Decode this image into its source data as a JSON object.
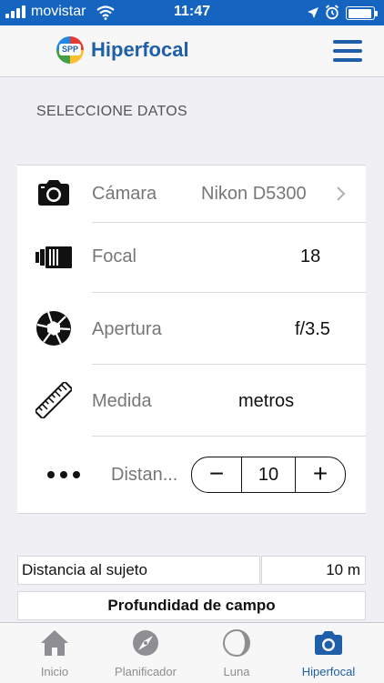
{
  "status_bar": {
    "carrier": "movistar",
    "time": "11:47"
  },
  "nav": {
    "logo_text": "SPP",
    "title": "Hiperfocal"
  },
  "section_title": "SELECCIONE DATOS",
  "rows": {
    "camera": {
      "label": "Cámara",
      "value": "Nikon D5300"
    },
    "focal": {
      "label": "Focal",
      "value": "18"
    },
    "aperture": {
      "label": "Apertura",
      "value": "f/3.5"
    },
    "measure": {
      "label": "Medida",
      "value": "metros"
    },
    "distance": {
      "label": "Distan...",
      "value": "10",
      "minus": "−",
      "plus": "+"
    }
  },
  "results": {
    "subject_distance_label": "Distancia al sujeto",
    "subject_distance_value": "10 m",
    "dof_header": "Profundidad de campo"
  },
  "tabs": [
    {
      "label": "Inicio",
      "icon": "home-icon"
    },
    {
      "label": "Planificador",
      "icon": "compass-icon"
    },
    {
      "label": "Luna",
      "icon": "moon-icon"
    },
    {
      "label": "Hiperfocal",
      "icon": "camera-icon",
      "active": true
    }
  ],
  "colors": {
    "accent": "#1f5ea8",
    "status_bar": "#1565c0",
    "tab_inactive": "#8e8e93"
  }
}
